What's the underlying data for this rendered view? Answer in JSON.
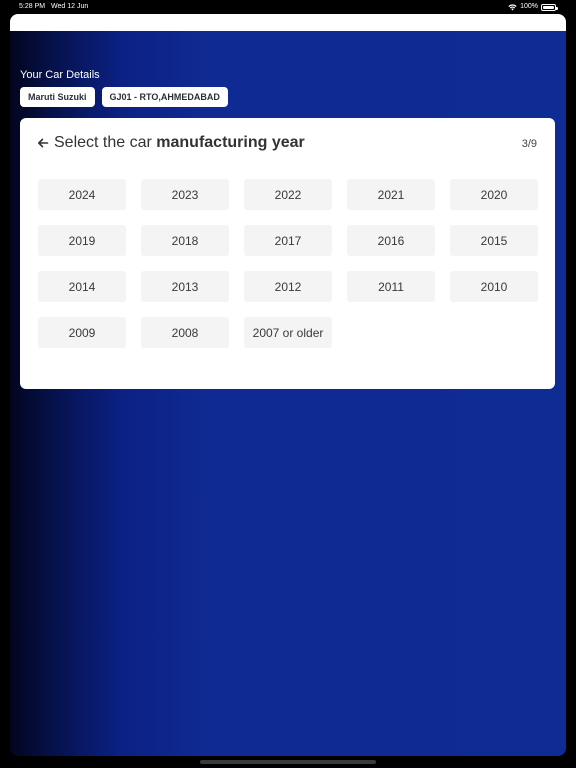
{
  "status_bar": {
    "time": "5:28 PM",
    "date": "Wed 12 Jun",
    "battery": "100%"
  },
  "details": {
    "label": "Your Car Details",
    "chips": [
      "Maruti Suzuki",
      "GJ01 - RTO,AHMEDABAD"
    ]
  },
  "card": {
    "title_prefix": "Select the car ",
    "title_bold": "manufacturing year",
    "step": "3/9",
    "years": [
      "2024",
      "2023",
      "2022",
      "2021",
      "2020",
      "2019",
      "2018",
      "2017",
      "2016",
      "2015",
      "2014",
      "2013",
      "2012",
      "2011",
      "2010",
      "2009",
      "2008",
      "2007 or older"
    ]
  },
  "colors": {
    "background_gradient_end": "#0f2b94",
    "card_bg": "#ffffff",
    "year_btn_bg": "#f4f4f4"
  },
  "icons": {
    "back": "arrow-left-icon",
    "wifi": "wifi-icon",
    "battery": "battery-icon"
  }
}
